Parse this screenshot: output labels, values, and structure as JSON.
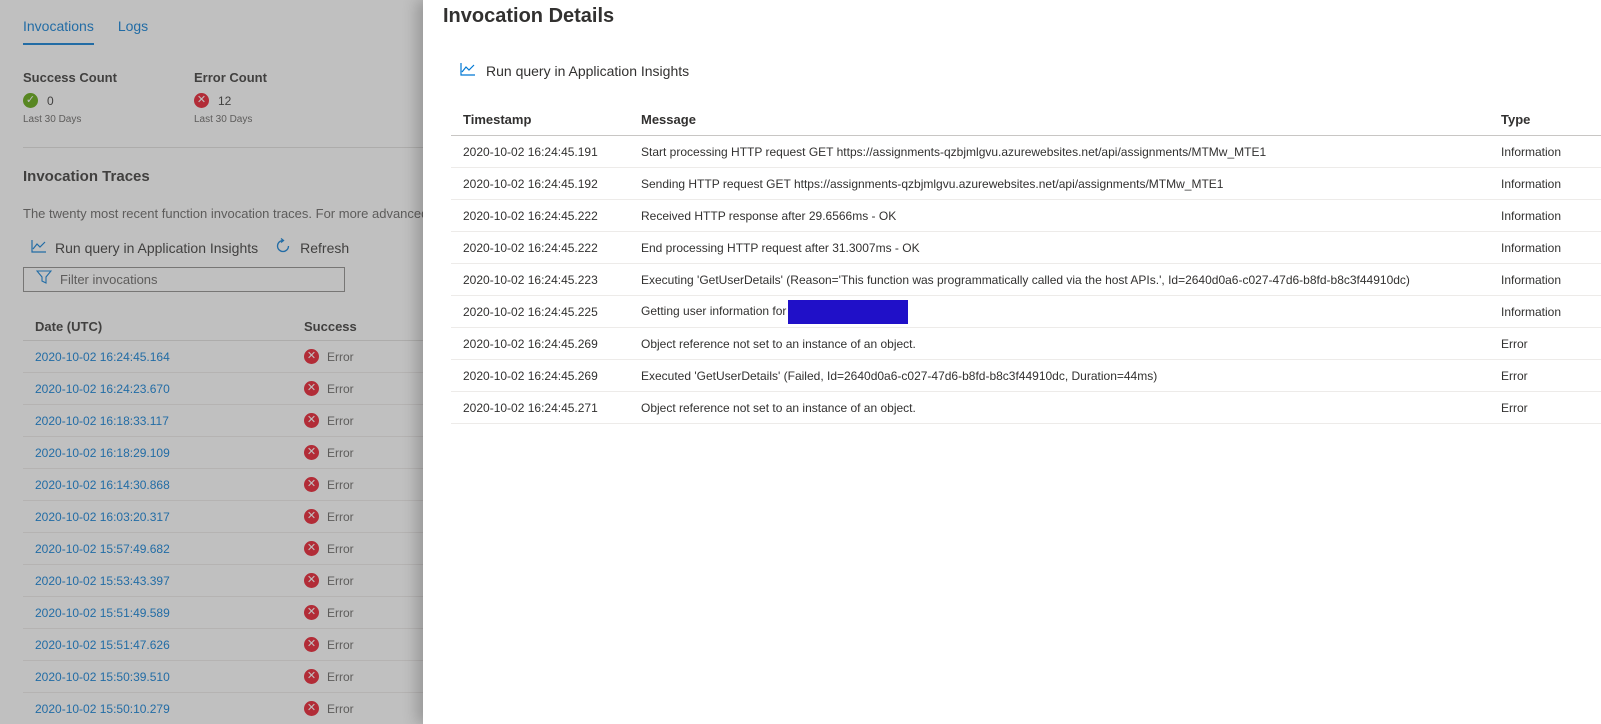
{
  "tabs": [
    {
      "label": "Invocations",
      "active": true
    },
    {
      "label": "Logs",
      "active": false
    }
  ],
  "success": {
    "title": "Success Count",
    "value": "0",
    "period": "Last 30 Days"
  },
  "error": {
    "title": "Error Count",
    "value": "12",
    "period": "Last 30 Days"
  },
  "traces": {
    "title": "Invocation Traces",
    "description": "The twenty most recent function invocation traces. For more advanced analysis, run the query in Application Insights.",
    "run_query_label": "Run query in Application Insights",
    "refresh_label": "Refresh",
    "filter_placeholder": "Filter invocations",
    "columns": [
      "Date (UTC)",
      "Success"
    ],
    "rows": [
      {
        "date": "2020-10-02 16:24:45.164",
        "status": "Error"
      },
      {
        "date": "2020-10-02 16:24:23.670",
        "status": "Error"
      },
      {
        "date": "2020-10-02 16:18:33.117",
        "status": "Error"
      },
      {
        "date": "2020-10-02 16:18:29.109",
        "status": "Error"
      },
      {
        "date": "2020-10-02 16:14:30.868",
        "status": "Error"
      },
      {
        "date": "2020-10-02 16:03:20.317",
        "status": "Error"
      },
      {
        "date": "2020-10-02 15:57:49.682",
        "status": "Error"
      },
      {
        "date": "2020-10-02 15:53:43.397",
        "status": "Error"
      },
      {
        "date": "2020-10-02 15:51:49.589",
        "status": "Error"
      },
      {
        "date": "2020-10-02 15:51:47.626",
        "status": "Error"
      },
      {
        "date": "2020-10-02 15:50:39.510",
        "status": "Error"
      },
      {
        "date": "2020-10-02 15:50:10.279",
        "status": "Error"
      }
    ]
  },
  "details": {
    "title": "Invocation Details",
    "run_query_label": "Run query in Application Insights",
    "columns": [
      "Timestamp",
      "Message",
      "Type"
    ],
    "rows": [
      {
        "timestamp": "2020-10-02 16:24:45.191",
        "message": "Start processing HTTP request GET https://assignments-qzbjmlgvu.azurewebsites.net/api/assignments/MTMw_MTE1",
        "type": "Information"
      },
      {
        "timestamp": "2020-10-02 16:24:45.192",
        "message": "Sending HTTP request GET https://assignments-qzbjmlgvu.azurewebsites.net/api/assignments/MTMw_MTE1",
        "type": "Information"
      },
      {
        "timestamp": "2020-10-02 16:24:45.222",
        "message": "Received HTTP response after 29.6566ms - OK",
        "type": "Information"
      },
      {
        "timestamp": "2020-10-02 16:24:45.222",
        "message": "End processing HTTP request after 31.3007ms - OK",
        "type": "Information"
      },
      {
        "timestamp": "2020-10-02 16:24:45.223",
        "message": "Executing 'GetUserDetails' (Reason='This function was programmatically called via the host APIs.', Id=2640d0a6-c027-47d6-b8fd-b8c3f44910dc)",
        "type": "Information"
      },
      {
        "timestamp": "2020-10-02 16:24:45.225",
        "message": "Getting user information for",
        "type": "Information",
        "redacted": true
      },
      {
        "timestamp": "2020-10-02 16:24:45.269",
        "message": "Object reference not set to an instance of an object.",
        "type": "Error"
      },
      {
        "timestamp": "2020-10-02 16:24:45.269",
        "message": "Executed 'GetUserDetails' (Failed, Id=2640d0a6-c027-47d6-b8fd-b8c3f44910dc, Duration=44ms)",
        "type": "Error"
      },
      {
        "timestamp": "2020-10-02 16:24:45.271",
        "message": "Object reference not set to an instance of an object.",
        "type": "Error"
      }
    ]
  }
}
